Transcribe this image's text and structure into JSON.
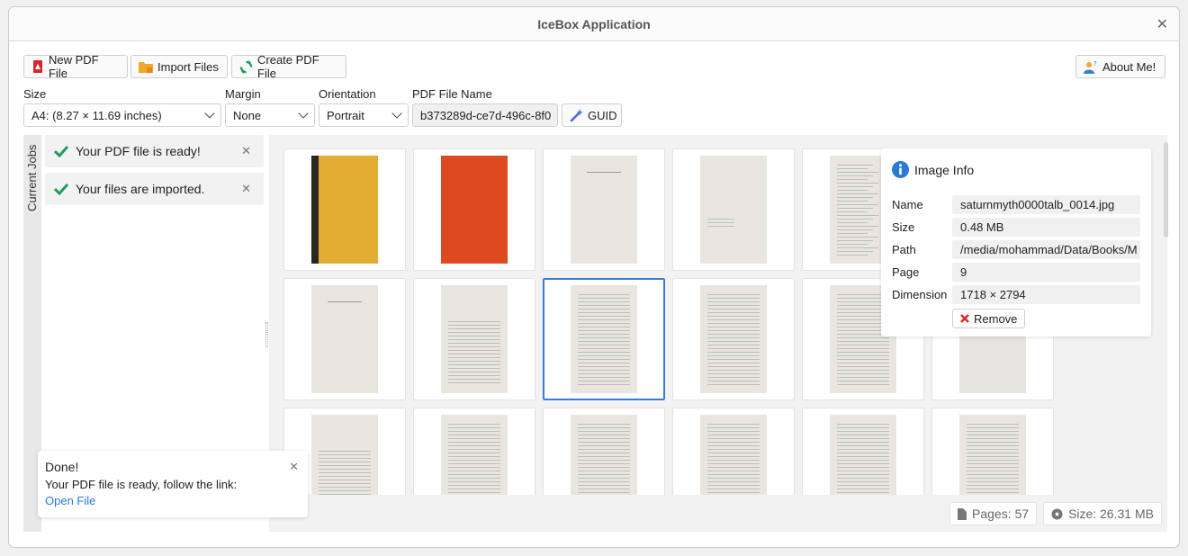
{
  "window": {
    "title": "IceBox Application"
  },
  "toolbar": {
    "new_pdf": "New PDF File",
    "import_files": "Import Files",
    "create_pdf": "Create PDF File",
    "about": "About Me!"
  },
  "settings": {
    "size_label": "Size",
    "size_value": "A4: (8.27 × 11.69 inches)",
    "margin_label": "Margin",
    "margin_value": "None",
    "orientation_label": "Orientation",
    "orientation_value": "Portrait",
    "filename_label": "PDF File Name",
    "filename_value": "b373289d-ce7d-496c-8f0",
    "guid_button": "GUID"
  },
  "jobs": {
    "tab_label": "Current Jobs",
    "items": [
      {
        "text": "Your PDF file is ready!"
      },
      {
        "text": "Your files are imported."
      }
    ]
  },
  "gallery": {
    "thumbnails": [
      {
        "kind": "yellow-cover"
      },
      {
        "kind": "red-cover"
      },
      {
        "kind": "title-page"
      },
      {
        "kind": "sparse-page"
      },
      {
        "kind": "contents-page"
      },
      {
        "kind": "hidden"
      },
      {
        "kind": "title-page"
      },
      {
        "kind": "chapter-page"
      },
      {
        "kind": "text-page",
        "selected": true
      },
      {
        "kind": "text-page"
      },
      {
        "kind": "text-page"
      },
      {
        "kind": "blank-page"
      },
      {
        "kind": "chapter-page"
      },
      {
        "kind": "text-page"
      },
      {
        "kind": "text-page"
      },
      {
        "kind": "text-page"
      },
      {
        "kind": "text-page"
      },
      {
        "kind": "text-page"
      }
    ]
  },
  "info": {
    "title": "Image Info",
    "rows": [
      {
        "label": "Name",
        "value": "saturnmyth0000talb_0014.jpg"
      },
      {
        "label": "Size",
        "value": "0.48 MB"
      },
      {
        "label": "Path",
        "value": "/media/mohammad/Data/Books/M"
      },
      {
        "label": "Page",
        "value": "9"
      },
      {
        "label": "Dimension",
        "value": "1718 × 2794"
      }
    ],
    "remove_button": "Remove"
  },
  "status": {
    "pages": "Pages: 57",
    "size": "Size: 26.31 MB"
  },
  "toast": {
    "title": "Done!",
    "message": "Your PDF file is ready, follow the link:",
    "link": "Open File"
  },
  "colors": {
    "accent": "#3a7bd5",
    "check": "#1e9e5a",
    "remove": "#e0282f",
    "pdf_icon": "#d9262e",
    "folder_icon": "#f0a92a"
  }
}
